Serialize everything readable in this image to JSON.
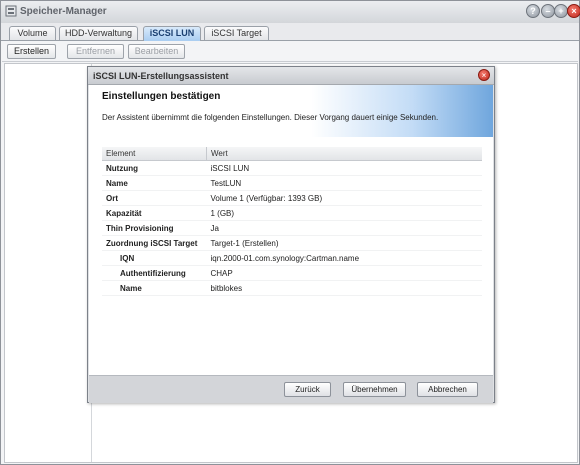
{
  "window": {
    "title": "Speicher-Manager",
    "buttons": {
      "help": "?",
      "min": "–",
      "max": "+",
      "close": "×"
    }
  },
  "tabs": [
    {
      "label": "Volume"
    },
    {
      "label": "HDD-Verwaltung"
    },
    {
      "label": "iSCSI LUN",
      "active": true
    },
    {
      "label": "iSCSI Target"
    }
  ],
  "toolbar": {
    "create": "Erstellen",
    "remove": "Entfernen",
    "edit": "Bearbeiten"
  },
  "dialog": {
    "title": "iSCSI LUN-Erstellungsassistent",
    "close": "×",
    "heading": "Einstellungen bestätigen",
    "description": "Der Assistent übernimmt die folgenden Einstellungen. Dieser Vorgang dauert einige Sekunden.",
    "table": {
      "columns": [
        "Element",
        "Wert"
      ],
      "rows": [
        {
          "element": "Nutzung",
          "value": "iSCSI LUN"
        },
        {
          "element": "Name",
          "value": "TestLUN"
        },
        {
          "element": "Ort",
          "value": "Volume 1 (Verfügbar: 1393 GB)"
        },
        {
          "element": "Kapazität",
          "value": "1 (GB)"
        },
        {
          "element": "Thin Provisioning",
          "value": "Ja"
        },
        {
          "element": "Zuordnung iSCSI Target",
          "value": "Target-1 (Erstellen)"
        },
        {
          "element": "IQN",
          "value": "iqn.2000-01.com.synology:Cartman.name",
          "sub": true
        },
        {
          "element": "Authentifizierung",
          "value": "CHAP",
          "sub": true
        },
        {
          "element": "Name",
          "value": "bitblokes",
          "sub": true
        }
      ]
    },
    "buttons": {
      "back": "Zurück",
      "apply": "Übernehmen",
      "cancel": "Abbrechen"
    }
  }
}
